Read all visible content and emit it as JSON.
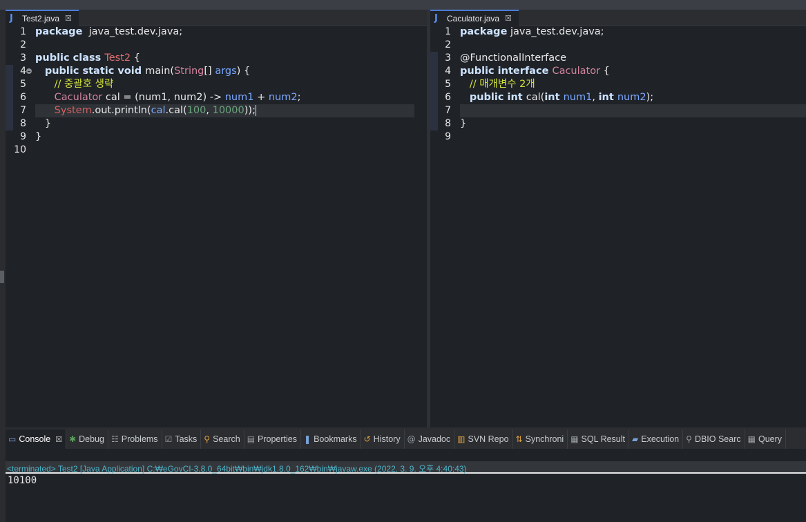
{
  "editors": {
    "left": {
      "tab_title": "Test2.java",
      "lines": [
        {
          "n": "1",
          "segs": [
            [
              "kw",
              "package"
            ],
            [
              "",
              "  java_test.dev.java;"
            ]
          ]
        },
        {
          "n": "2",
          "segs": []
        },
        {
          "n": "3",
          "segs": [
            [
              "kw",
              "public class "
            ],
            [
              "cls",
              "Test2"
            ],
            [
              "",
              " {"
            ]
          ]
        },
        {
          "n": "4",
          "segs": [
            [
              "",
              "   "
            ],
            [
              "kw",
              "public static void "
            ],
            [
              "",
              "main("
            ],
            [
              "str",
              "String"
            ],
            [
              "",
              "[] "
            ],
            [
              "fld",
              "args"
            ],
            [
              "",
              ") {"
            ]
          ]
        },
        {
          "n": "5",
          "segs": [
            [
              "",
              "      "
            ],
            [
              "cmt",
              "// 중괄호 생략"
            ]
          ]
        },
        {
          "n": "6",
          "segs": [
            [
              "",
              "      "
            ],
            [
              "type",
              "Caculator"
            ],
            [
              "",
              " cal = (num1, num2) -> "
            ],
            [
              "fld",
              "num1"
            ],
            [
              "",
              " + "
            ],
            [
              "fld",
              "num2"
            ],
            [
              "",
              ";"
            ]
          ]
        },
        {
          "n": "7",
          "segs": [
            [
              "",
              "      "
            ],
            [
              "sys",
              "System"
            ],
            [
              "",
              ".out.println("
            ],
            [
              "fld",
              "cal"
            ],
            [
              "",
              ".cal("
            ],
            [
              "num",
              "100"
            ],
            [
              "",
              ", "
            ],
            [
              "num",
              "10000"
            ],
            [
              "",
              "));"
            ]
          ]
        },
        {
          "n": "8",
          "segs": [
            [
              "",
              "   }"
            ]
          ]
        },
        {
          "n": "9",
          "segs": [
            [
              "",
              "}"
            ]
          ]
        },
        {
          "n": "10",
          "segs": []
        }
      ]
    },
    "right": {
      "tab_title": "Caculator.java",
      "lines": [
        {
          "n": "1",
          "segs": [
            [
              "kw",
              "package"
            ],
            [
              "",
              " java_test.dev.java;"
            ]
          ]
        },
        {
          "n": "2",
          "segs": []
        },
        {
          "n": "3",
          "segs": [
            [
              "",
              "@FunctionalInterface"
            ]
          ]
        },
        {
          "n": "4",
          "segs": [
            [
              "kw",
              "public interface "
            ],
            [
              "type",
              "Caculator"
            ],
            [
              "",
              " {"
            ]
          ]
        },
        {
          "n": "5",
          "segs": [
            [
              "",
              "   "
            ],
            [
              "cmt",
              "// 매개변수 2개"
            ]
          ]
        },
        {
          "n": "6",
          "segs": [
            [
              "",
              "   "
            ],
            [
              "kw",
              "public int "
            ],
            [
              "",
              "cal("
            ],
            [
              "kw",
              "int "
            ],
            [
              "fld",
              "num1"
            ],
            [
              "",
              ", "
            ],
            [
              "kw",
              "int "
            ],
            [
              "fld",
              "num2"
            ],
            [
              "",
              ");"
            ]
          ]
        },
        {
          "n": "7",
          "segs": []
        },
        {
          "n": "8",
          "segs": [
            [
              "",
              "}"
            ]
          ]
        },
        {
          "n": "9",
          "segs": []
        }
      ]
    }
  },
  "views": [
    {
      "label": "Console",
      "icon": "console-icon",
      "glyph": "▭",
      "active": true
    },
    {
      "label": "Debug",
      "icon": "bug-icon",
      "glyph": "✱",
      "cls": "green"
    },
    {
      "label": "Problems",
      "icon": "problems-icon",
      "glyph": "☷",
      "cls": "gray"
    },
    {
      "label": "Tasks",
      "icon": "tasks-icon",
      "glyph": "☑",
      "cls": "gray"
    },
    {
      "label": "Search",
      "icon": "search-icon",
      "glyph": "⚲",
      "cls": "orange"
    },
    {
      "label": "Properties",
      "icon": "properties-icon",
      "glyph": "▤",
      "cls": "gray"
    },
    {
      "label": "Bookmarks",
      "icon": "bookmark-icon",
      "glyph": "❚"
    },
    {
      "label": "History",
      "icon": "history-icon",
      "glyph": "↺",
      "cls": "orange"
    },
    {
      "label": "Javadoc",
      "icon": "javadoc-icon",
      "glyph": "@",
      "cls": "gray"
    },
    {
      "label": "SVN Repo",
      "icon": "svn-repo-icon",
      "glyph": "▥",
      "cls": "orange"
    },
    {
      "label": "Synchroni",
      "icon": "synchronize-icon",
      "glyph": "⇅",
      "cls": "orange"
    },
    {
      "label": "SQL Result",
      "icon": "sql-result-icon",
      "glyph": "▦",
      "cls": "gray"
    },
    {
      "label": "Execution",
      "icon": "execution-icon",
      "glyph": "▰"
    },
    {
      "label": "DBIO Searc",
      "icon": "dbio-search-icon",
      "glyph": "⚲",
      "cls": "gray"
    },
    {
      "label": "Query",
      "icon": "query-icon",
      "glyph": "▦",
      "cls": "gray"
    }
  ],
  "console": {
    "status": "<terminated> Test2 [Java Application] C:₩eGovCI-3.8.0_64bit₩bin₩jdk1.8.0_162₩bin₩javaw.exe (2022. 3. 9. 오후 4:40:43)",
    "output": "10100"
  },
  "colors": {
    "editor_bg": "#1f2227",
    "keyword": "#cde3ff",
    "type": "#d3849d",
    "comment": "#d2e23a",
    "number": "#6aa47c",
    "field": "#7aa8ff",
    "status": "#4fb3c8"
  }
}
